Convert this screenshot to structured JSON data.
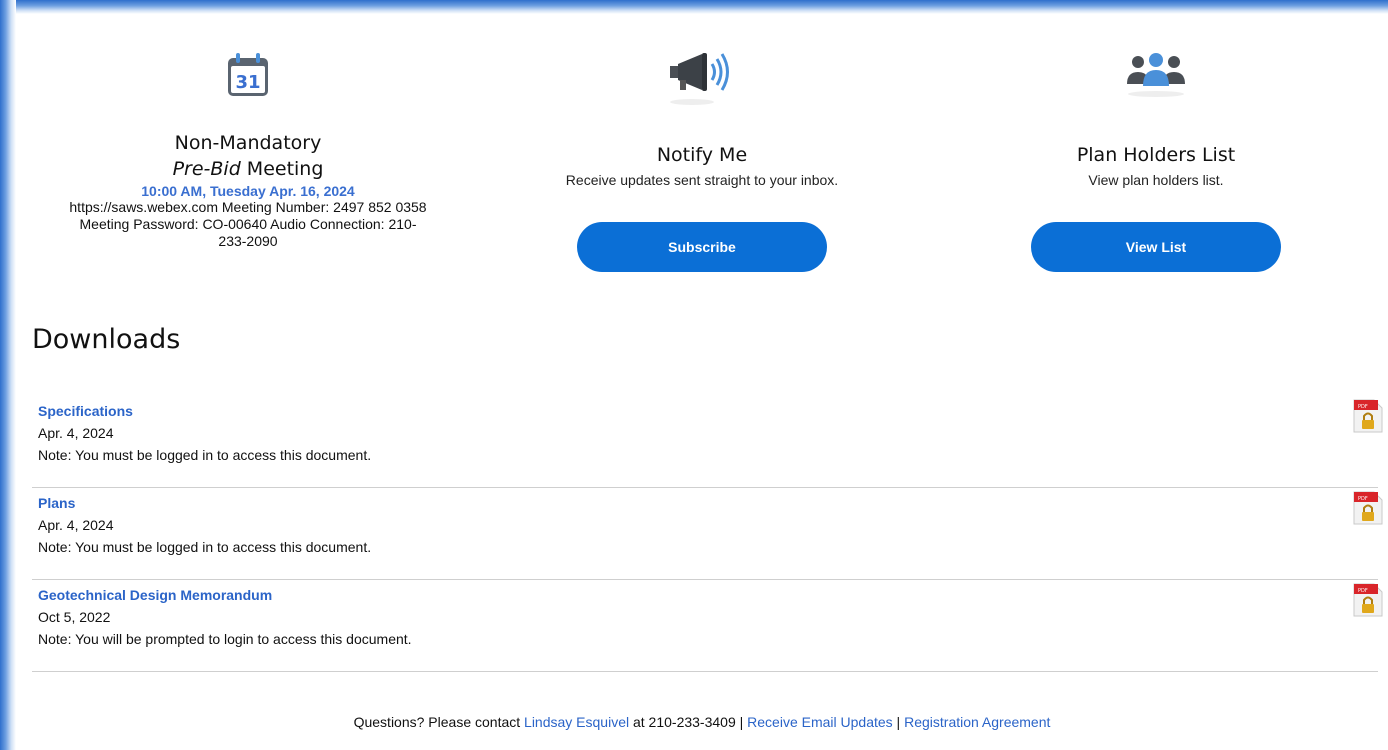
{
  "features": {
    "meeting": {
      "title_line1": "Non-Mandatory",
      "title_em": "Pre-Bid",
      "title_rest": " Meeting",
      "date": "10:00 AM, Tuesday Apr. 16, 2024",
      "info_line1": "https://saws.webex.com Meeting Number: 2497 852 0358",
      "info_line2": "Meeting Password: CO-00640 Audio Connection: 210-",
      "info_line3": "233-2090",
      "icon": "calendar-icon",
      "calendar_day": "31"
    },
    "notify": {
      "title": "Notify Me",
      "subtitle": "Receive updates sent straight to your inbox.",
      "button": "Subscribe",
      "icon": "megaphone-icon"
    },
    "planholders": {
      "title": "Plan Holders List",
      "subtitle": "View plan holders list.",
      "button": "View List",
      "icon": "people-icon"
    }
  },
  "downloads": {
    "heading": "Downloads",
    "items": [
      {
        "name": "Specifications",
        "date": "Apr. 4, 2024",
        "note": "Note: You must be logged in to access this document.",
        "icon": "locked-pdf-icon"
      },
      {
        "name": "Plans",
        "date": "Apr. 4, 2024",
        "note": "Note: You must be logged in to access this document.",
        "icon": "locked-pdf-icon"
      },
      {
        "name": "Geotechnical Design Memorandum",
        "date": "Oct 5, 2022",
        "note": "Note: You will be prompted to login to access this document.",
        "icon": "locked-pdf-icon"
      }
    ]
  },
  "footer": {
    "prefix": "Questions? Please contact ",
    "contact_name": "Lindsay Esquivel",
    "phone_text": " at 210-233-3409 | ",
    "email_updates": "Receive Email Updates",
    "separator": " | ",
    "registration": "Registration Agreement"
  },
  "colors": {
    "accent_button": "#0b6fd6",
    "link": "#2b64c8",
    "date_highlight": "#3a6fd0"
  }
}
